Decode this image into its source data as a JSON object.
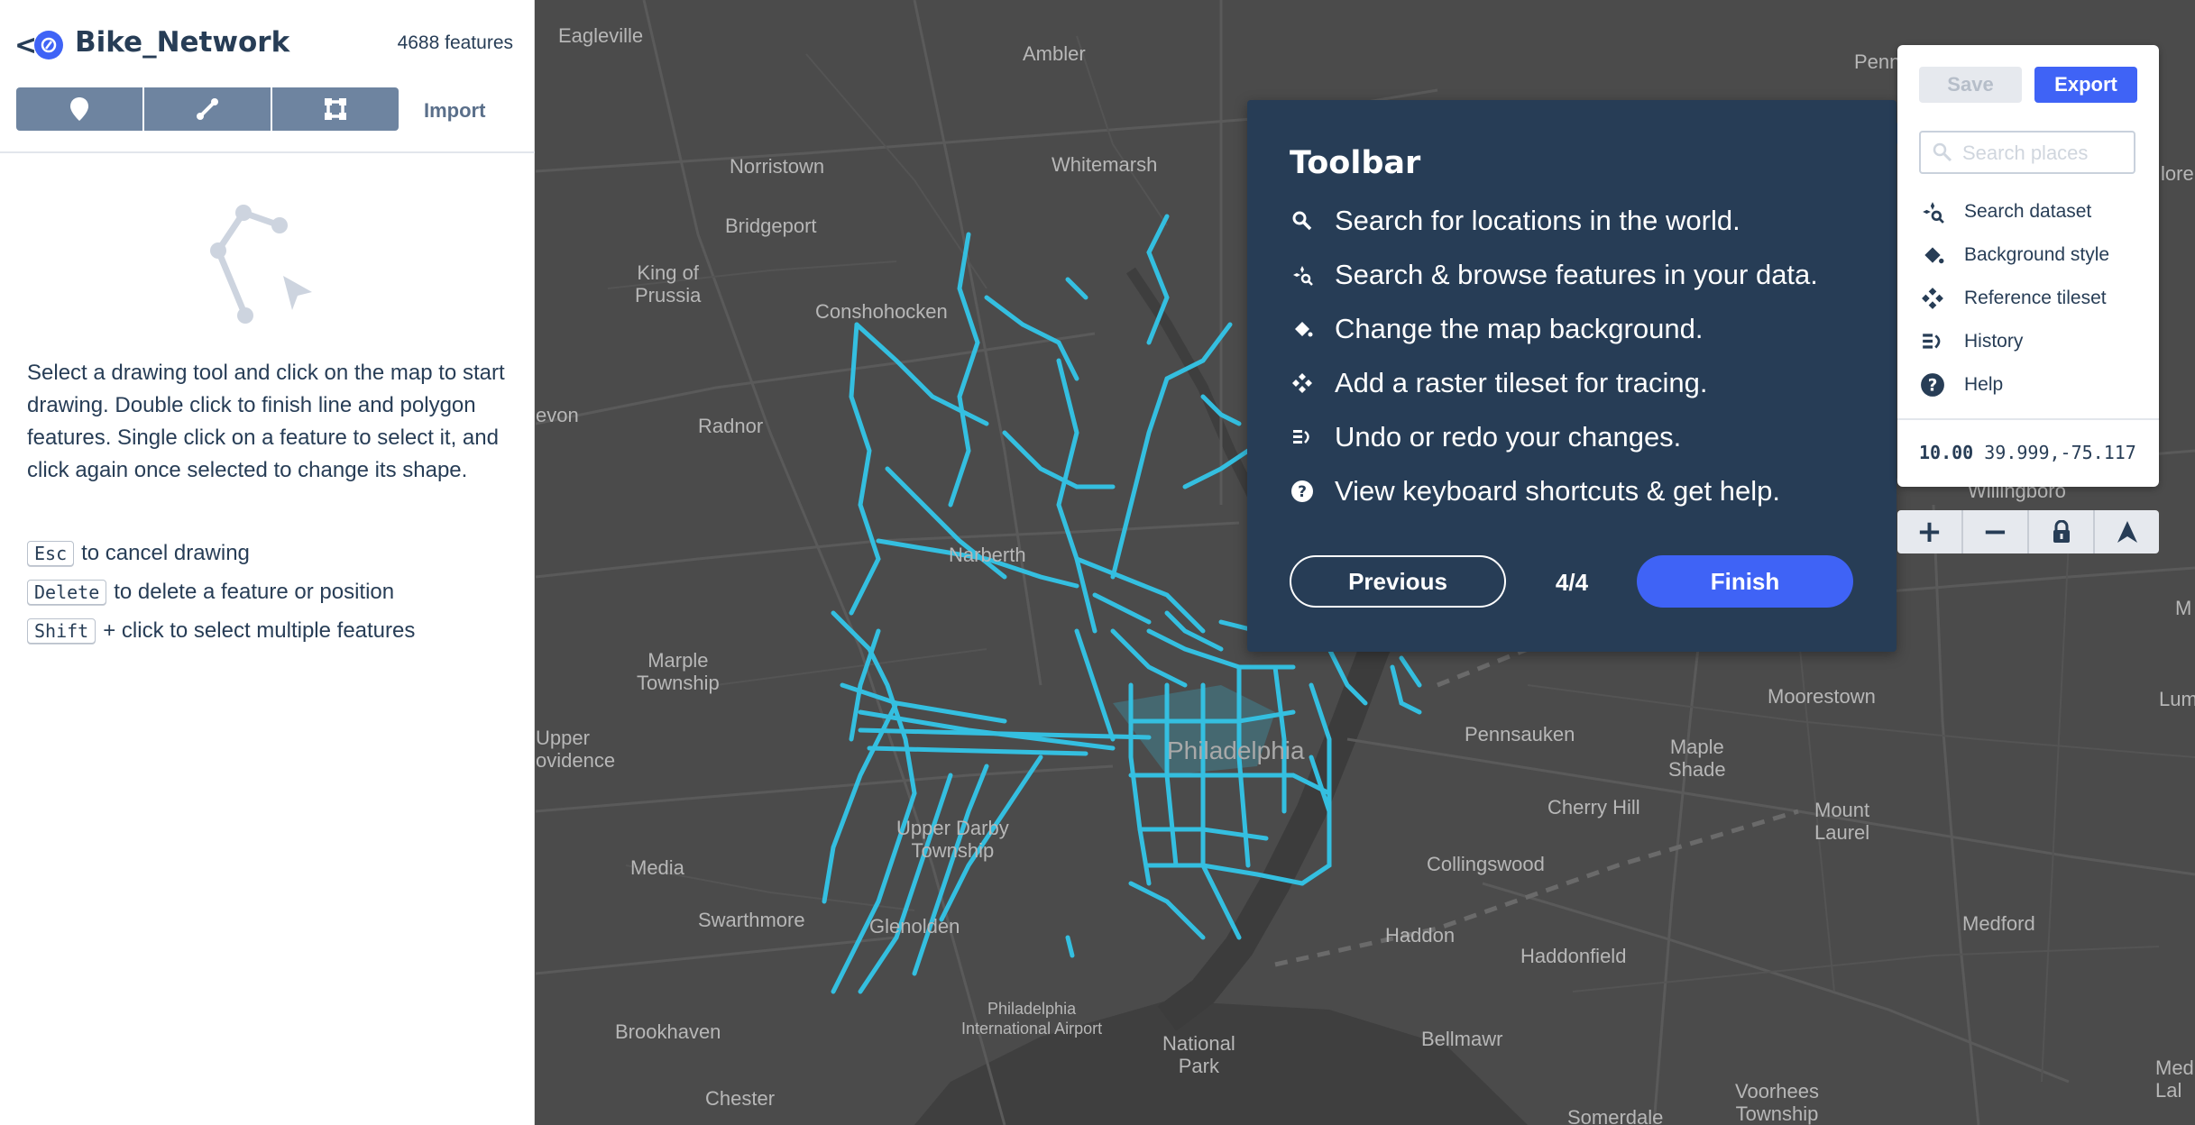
{
  "sidebar": {
    "back": "<",
    "dataset_name": "Bike_Network",
    "feature_count": "4688 features",
    "draw_tools": [
      {
        "name": "point",
        "icon": "marker-icon"
      },
      {
        "name": "line",
        "icon": "line-icon"
      },
      {
        "name": "polygon",
        "icon": "polygon-icon"
      }
    ],
    "import_label": "Import",
    "instructions": "Select a drawing tool and click on the map to start drawing. Double click to finish line and polygon features. Single click on a feature to select it, and click again once selected to change its shape.",
    "shortcuts": [
      {
        "key": "Esc",
        "text": "to cancel drawing"
      },
      {
        "key": "Delete",
        "text": "to delete a feature or position"
      },
      {
        "key": "Shift",
        "text": "+ click to select multiple features"
      }
    ]
  },
  "toolbar": {
    "save_label": "Save",
    "export_label": "Export",
    "search_placeholder": "Search places",
    "items": [
      {
        "label": "Search dataset",
        "icon": "search-dataset-icon"
      },
      {
        "label": "Background style",
        "icon": "paint-bucket-icon"
      },
      {
        "label": "Reference tileset",
        "icon": "tileset-icon"
      },
      {
        "label": "History",
        "icon": "history-icon"
      },
      {
        "label": "Help",
        "icon": "help-icon"
      }
    ],
    "zoom": "10.00",
    "coords": "39.999,-75.117"
  },
  "map_controls": [
    "+",
    "−",
    "lock",
    "compass"
  ],
  "tour": {
    "title": "Toolbar",
    "items": [
      {
        "text": "Search for locations in the world.",
        "icon": "search-icon"
      },
      {
        "text": "Search & browse features in your data.",
        "icon": "search-dataset-icon"
      },
      {
        "text": "Change the map background.",
        "icon": "paint-bucket-icon"
      },
      {
        "text": "Add a raster tileset for tracing.",
        "icon": "tileset-icon"
      },
      {
        "text": "Undo or redo your changes.",
        "icon": "history-icon"
      },
      {
        "text": "View keyboard shortcuts & get help.",
        "icon": "help-icon"
      }
    ],
    "prev_label": "Previous",
    "step": "4/4",
    "finish_label": "Finish"
  },
  "map": {
    "places": [
      {
        "name": "Eagleville"
      },
      {
        "name": "Ambler"
      },
      {
        "name": "Norristown"
      },
      {
        "name": "Whitemarsh"
      },
      {
        "name": "Bridgeport"
      },
      {
        "name": "King of\nPrussia"
      },
      {
        "name": "Conshohocken"
      },
      {
        "name": "Radnor"
      },
      {
        "name": "evon"
      },
      {
        "name": "Narberth"
      },
      {
        "name": "Marple\nTownship"
      },
      {
        "name": "Upper\novidence"
      },
      {
        "name": "Philadelphia"
      },
      {
        "name": "Upper Darby\nTownship"
      },
      {
        "name": "Media"
      },
      {
        "name": "Swarthmore"
      },
      {
        "name": "Glenolden"
      },
      {
        "name": "Philadelphia\nInternational Airport"
      },
      {
        "name": "Brookhaven"
      },
      {
        "name": "Chester"
      },
      {
        "name": "National\nPark"
      },
      {
        "name": "Bellmawr"
      },
      {
        "name": "Haddon"
      },
      {
        "name": "Haddonfield"
      },
      {
        "name": "Collingswood"
      },
      {
        "name": "Cherry Hill"
      },
      {
        "name": "Pennsauken"
      },
      {
        "name": "Maple\nShade"
      },
      {
        "name": "Moorestown"
      },
      {
        "name": "Mount\nLaurel"
      },
      {
        "name": "Medford"
      },
      {
        "name": "Voorhees\nTownship"
      },
      {
        "name": "Somerdale"
      },
      {
        "name": "Willingboro"
      },
      {
        "name": "Penn"
      },
      {
        "name": "lore"
      },
      {
        "name": "Lumb"
      },
      {
        "name": "Med\nLal"
      },
      {
        "name": "M"
      }
    ],
    "bike_color": "#34bfe0"
  }
}
